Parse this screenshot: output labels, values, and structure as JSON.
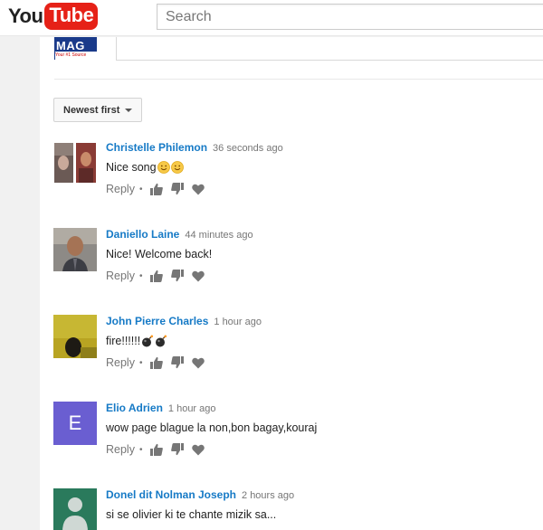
{
  "header": {
    "logo_you": "You",
    "logo_tube": "Tube",
    "search_placeholder": "Search"
  },
  "top_thumb": {
    "title": "MAG",
    "subtitle": "Your #1 Source"
  },
  "sort": {
    "label": "Newest first"
  },
  "comments": [
    {
      "author": "Christelle Philemon",
      "time": "36 seconds ago",
      "text": "Nice song",
      "emoji": [
        "smile-emoji",
        "smile-emoji"
      ],
      "avatar": "photo-pair"
    },
    {
      "author": "Daniello Laine",
      "time": "44 minutes ago",
      "text": "Nice! Welcome back!",
      "emoji": [],
      "avatar": "photo-man"
    },
    {
      "author": "John Pierre Charles",
      "time": "1 hour ago",
      "text": "fire!!!!!!",
      "emoji": [
        "bomb-emoji",
        "bomb-emoji"
      ],
      "avatar": "photo-yellow"
    },
    {
      "author": "Elio Adrien",
      "time": "1 hour ago",
      "text": "wow page blague la non,bon bagay,kouraj",
      "emoji": [],
      "avatar": "letter",
      "avatar_letter": "E",
      "avatar_color": "#6a5ed1"
    },
    {
      "author": "Donel dit Nolman Joseph",
      "time": "2 hours ago",
      "text": "si se olivier ki te chante mizik sa...",
      "emoji": [],
      "avatar": "default-user",
      "avatar_color": "#2a7a5c"
    }
  ],
  "actions": {
    "reply_label": "Reply",
    "separator": "•"
  }
}
